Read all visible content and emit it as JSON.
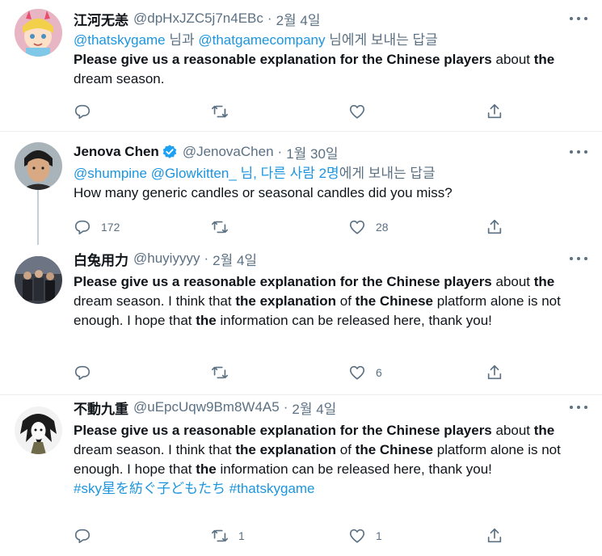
{
  "tweets": [
    {
      "name": "江河无恙",
      "handle": "@dpHxJZC5j7n4EBc",
      "dot": "·",
      "date": "2월 4일",
      "reply_to": {
        "link1": "@thatskygame",
        "mid": " 님과 ",
        "link2": "@thatgamecompany",
        "suffix": " 님에게 보내는 답글"
      },
      "text": [
        {
          "b": true,
          "t": "Please give us a reasonable explanation for the Chinese players"
        },
        {
          "b": false,
          "t": " about "
        },
        {
          "b": true,
          "t": "the"
        },
        {
          "b": false,
          "t": " dream season."
        }
      ],
      "counts": {
        "reply": "",
        "retweet": "",
        "like": ""
      }
    },
    {
      "name": "Jenova Chen",
      "handle": "@JenovaChen",
      "dot": "·",
      "date": "1월 30일",
      "verified_icon": "verified-badge-icon",
      "reply_to": {
        "link1": "@shumpine",
        "mid": " ",
        "link2": "@Glowkitten_",
        "link3": " 님, 다른 사람 2명",
        "suffix": "에게 보내는 답글"
      },
      "text": [
        {
          "b": false,
          "t": "How many generic candles or seasonal candles did you miss?"
        }
      ],
      "counts": {
        "reply": "172",
        "retweet": "",
        "like": "28"
      }
    },
    {
      "name": "白兔用力",
      "handle": "@huyiyyyy",
      "dot": "·",
      "date": "2월 4일",
      "text": [
        {
          "b": true,
          "t": "Please give us a reasonable explanation for the Chinese players"
        },
        {
          "b": false,
          "t": " about "
        },
        {
          "b": true,
          "t": "the"
        },
        {
          "b": false,
          "t": " dream season. I think that "
        },
        {
          "b": true,
          "t": "the explanation"
        },
        {
          "b": false,
          "t": " of "
        },
        {
          "b": true,
          "t": "the Chinese"
        },
        {
          "b": false,
          "t": " platform alone is not enough. I hope that "
        },
        {
          "b": true,
          "t": "the"
        },
        {
          "b": false,
          "t": " information can be released here, thank you!"
        }
      ],
      "counts": {
        "reply": "",
        "retweet": "",
        "like": "6"
      }
    },
    {
      "name": "不動九重",
      "handle": "@uEpcUqw9Bm8W4A5",
      "dot": "·",
      "date": "2월 4일",
      "text": [
        {
          "b": true,
          "t": "Please give us a reasonable explanation for the Chinese players"
        },
        {
          "b": false,
          "t": " about "
        },
        {
          "b": true,
          "t": "the"
        },
        {
          "b": false,
          "t": " dream season. I think that "
        },
        {
          "b": true,
          "t": "the explanation"
        },
        {
          "b": false,
          "t": " of "
        },
        {
          "b": true,
          "t": "the Chinese"
        },
        {
          "b": false,
          "t": " platform alone is not enough. I hope that "
        },
        {
          "b": true,
          "t": "the"
        },
        {
          "b": false,
          "t": " information can be released here, thank you!"
        }
      ],
      "hashtags": "#sky星を紡ぐ子どもたち #thatskygame",
      "counts": {
        "reply": "",
        "retweet": "1",
        "like": "1"
      }
    }
  ],
  "icons": {
    "reply": "reply-icon",
    "retweet": "retweet-icon",
    "like": "like-icon",
    "share": "share-icon",
    "more": "more-icon"
  },
  "colors": {
    "link": "#1b95e0",
    "secondary": "#5b7083",
    "text": "#0f1419",
    "verified": "#1da1f2",
    "divider": "#ebeef0"
  }
}
